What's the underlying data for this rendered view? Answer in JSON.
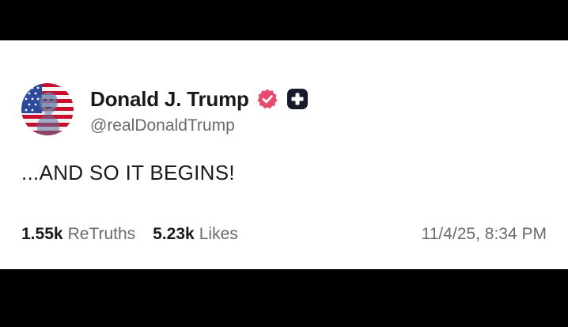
{
  "post": {
    "author": {
      "display_name": "Donald J. Trump",
      "handle": "@realDonaldTrump",
      "avatar_icon": "avatar-flag-portrait-icon",
      "verified_icon": "verified-check-badge-icon",
      "verified_color": "#e84a6f",
      "plus_icon": "plus-badge-icon"
    },
    "text": "...AND SO IT BEGINS!",
    "stats": {
      "retruths_count": "1.55k",
      "retruths_label": "ReTruths",
      "likes_count": "5.23k",
      "likes_label": "Likes"
    },
    "timestamp": "11/4/25, 8:34 PM"
  },
  "colors": {
    "letterbox": "#000000",
    "card_background": "#ffffff",
    "primary_text": "#1a1a1a",
    "secondary_text": "#6b6b6b"
  }
}
